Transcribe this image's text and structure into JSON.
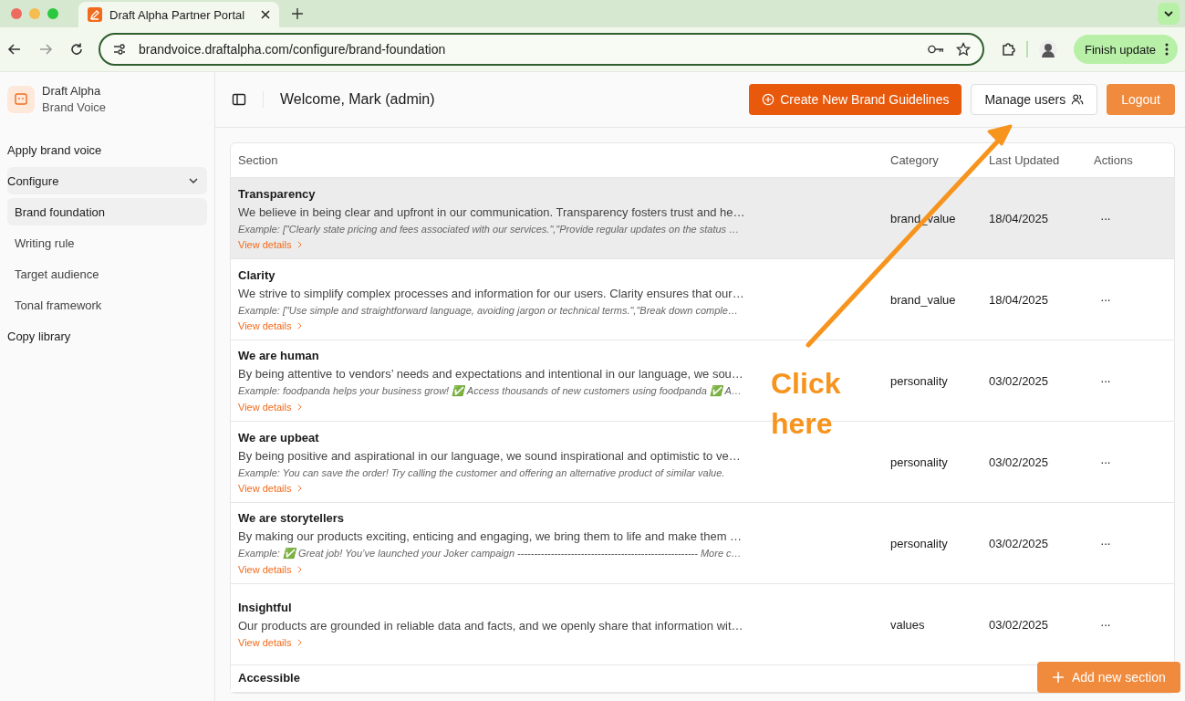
{
  "browser": {
    "tab_title": "Draft Alpha Partner Portal",
    "url": "brandvoice.draftalpha.com/configure/brand-foundation",
    "update_button": "Finish update"
  },
  "sidebar": {
    "brand_name": "Draft Alpha",
    "brand_sub": "Brand Voice",
    "items": [
      {
        "label": "Apply brand voice"
      },
      {
        "label": "Configure",
        "expanded": true,
        "children": [
          {
            "label": "Brand foundation",
            "selected": true
          },
          {
            "label": "Writing rule",
            "selected": false
          },
          {
            "label": "Target audience",
            "selected": false
          },
          {
            "label": "Tonal framework",
            "selected": false
          }
        ]
      },
      {
        "label": "Copy library"
      }
    ]
  },
  "header": {
    "welcome": "Welcome, Mark (admin)",
    "create_button": "Create New Brand Guidelines",
    "manage_button": "Manage users",
    "logout_button": "Logout"
  },
  "table": {
    "columns": [
      "Section",
      "Category",
      "Last Updated",
      "Actions"
    ],
    "rows": [
      {
        "title": "Transparency",
        "description": "We believe in being clear and upfront in our communication. Transparency fosters trust and he…",
        "example": "Example: [\"Clearly state pricing and fees associated with our services.\",\"Provide regular updates on the status …",
        "category": "brand_value",
        "updated": "18/04/2025",
        "link": "View details",
        "actions": "···",
        "highlighted": true
      },
      {
        "title": "Clarity",
        "description": "We strive to simplify complex processes and information for our users. Clarity ensures that our…",
        "example": "Example: [\"Use simple and straightforward language, avoiding jargon or technical terms.\",\"Break down comple…",
        "category": "brand_value",
        "updated": "18/04/2025",
        "link": "View details",
        "actions": "···",
        "highlighted": false
      },
      {
        "title": "We are human",
        "description": "By being attentive to vendors’ needs and expectations and intentional in our language, we sou…",
        "example": "Example: foodpanda helps your business grow! ✅ Access thousands of new customers using foodpanda ✅ A…",
        "category": "personality",
        "updated": "03/02/2025",
        "link": "View details",
        "actions": "···",
        "highlighted": false
      },
      {
        "title": "We are upbeat",
        "description": "By being positive and aspirational in our language, we sound inspirational and optimistic to ve…",
        "example": "Example: You can save the order! Try calling the customer and offering an alternative product of similar value.",
        "category": "personality",
        "updated": "03/02/2025",
        "link": "View details",
        "actions": "···",
        "highlighted": false
      },
      {
        "title": "We are storytellers",
        "description": "By making our products exciting, enticing and engaging, we bring them to life and make them …",
        "example": "Example: ✅ Great job! You’ve launched your Joker campaign ------------------------------------------------------ More c…",
        "category": "personality",
        "updated": "03/02/2025",
        "link": "View details",
        "actions": "···",
        "highlighted": false
      },
      {
        "title": "Insightful",
        "description": "Our products are grounded in reliable data and facts, and we openly share that information wit…",
        "category": "values",
        "updated": "03/02/2025",
        "link": "View details",
        "actions": "···",
        "highlighted": false
      },
      {
        "title": "Accessible"
      }
    ]
  },
  "add_button": "Add new section",
  "annotation": {
    "text": "Click here"
  }
}
